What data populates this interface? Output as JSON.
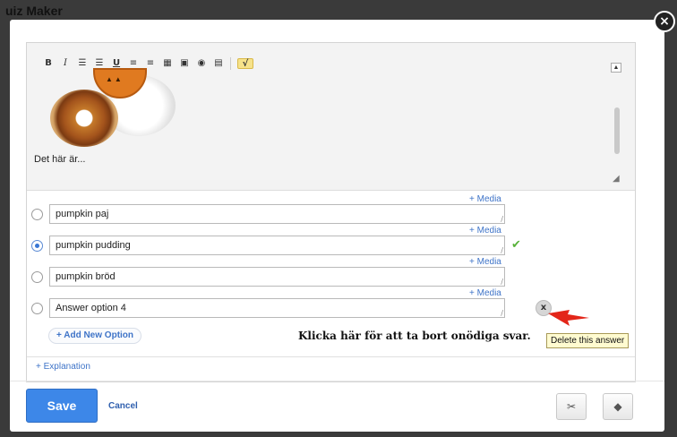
{
  "background": {
    "title": "uiz Maker"
  },
  "modal": {
    "close_icon": "close-icon",
    "close_symbol": "×"
  },
  "editor": {
    "toolbar": [
      {
        "name": "bold-icon",
        "glyph": "B",
        "cls": "bold"
      },
      {
        "name": "italic-icon",
        "glyph": "I",
        "cls": "ital"
      },
      {
        "name": "ordered-list-icon",
        "glyph": "☰",
        "cls": ""
      },
      {
        "name": "unordered-list-icon",
        "glyph": "☰",
        "cls": ""
      },
      {
        "name": "underline-icon",
        "glyph": "U",
        "cls": "under"
      },
      {
        "name": "align-left-icon",
        "glyph": "≡",
        "cls": ""
      },
      {
        "name": "align-right-icon",
        "glyph": "≡",
        "cls": ""
      },
      {
        "name": "table-icon",
        "glyph": "▦",
        "cls": ""
      },
      {
        "name": "image-icon",
        "glyph": "▣",
        "cls": ""
      },
      {
        "name": "link-icon",
        "glyph": "◉",
        "cls": ""
      },
      {
        "name": "media-icon",
        "glyph": "▤",
        "cls": ""
      },
      {
        "name": "sqrt-icon",
        "glyph": "√",
        "cls": "sqrt"
      }
    ],
    "text": "Det här är..."
  },
  "options": [
    {
      "media": "+ Media",
      "value": "pumpkin paj",
      "selected": false,
      "correct": false
    },
    {
      "media": "+ Media",
      "value": "pumpkin pudding",
      "selected": true,
      "correct": true
    },
    {
      "media": "+ Media",
      "value": "pumpkin bröd",
      "selected": false,
      "correct": false
    },
    {
      "media": "+ Media",
      "value": "Answer option 4",
      "selected": false,
      "correct": false
    }
  ],
  "correct_mark": "✔",
  "delete_symbol": "x",
  "add_option_label": "+ Add New Option",
  "hint_text": "Klicka här för att ta bort onödiga svar.",
  "tooltip": "Delete this answer",
  "explanation_label": "+ Explanation",
  "footer": {
    "save_label": "Save",
    "cancel_label": "Cancel",
    "tools_icon": "✂",
    "tag_icon": "◆"
  }
}
